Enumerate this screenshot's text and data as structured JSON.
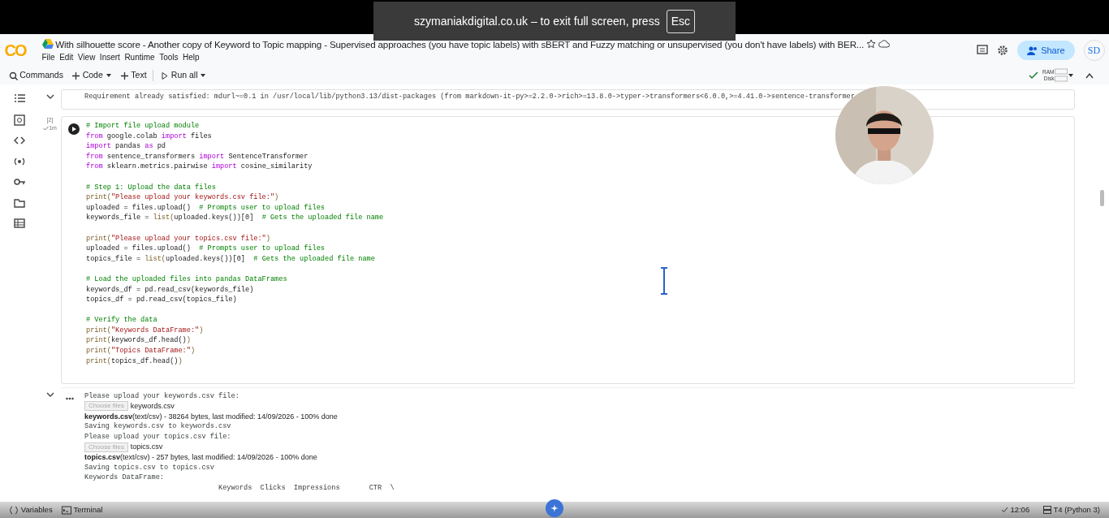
{
  "fullscreen_notice": {
    "text": "szymaniakdigital.co.uk – to exit full screen, press",
    "key": "Esc"
  },
  "header": {
    "logo": "CO",
    "title": "With silhouette score - Another copy of Keyword to Topic mapping - Supervised approaches (you have topic labels) with sBERT and Fuzzy matching or unsupervised (you don't have labels) with BER...",
    "menu": [
      "File",
      "Edit",
      "View",
      "Insert",
      "Runtime",
      "Tools",
      "Help"
    ],
    "share": "Share",
    "avatar": "SD"
  },
  "toolbar": {
    "items": [
      {
        "kind": "search",
        "label": "Commands",
        "caret": false
      },
      {
        "kind": "add",
        "label": "Code",
        "caret": true
      },
      {
        "kind": "add",
        "label": "Text",
        "caret": false
      },
      {
        "kind": "run",
        "label": "Run all",
        "caret": true
      }
    ],
    "ram": "RAM",
    "disk": "Disk"
  },
  "cells": [
    {
      "kind": "output_collapsed",
      "text": "Requirement already satisfied: mdurl~=0.1 in /usr/local/lib/python3.13/dist-packages (from markdown-it-py>=2.2.0->rich>=13.8.0->typer->transformers<6.0.0,>=4.41.0->sentence-transformer"
    },
    {
      "kind": "code",
      "exec_count": "[2]",
      "duration": "1m",
      "blocks": [
        [
          [
            {
              "kind": "comment",
              "text": "# Import file upload module"
            }
          ],
          [
            {
              "kind": "kw",
              "text": "from"
            },
            {
              "kind": "plain",
              "text": " google.colab "
            },
            {
              "kind": "kw",
              "text": "import"
            },
            {
              "kind": "plain",
              "text": " files"
            }
          ],
          [
            {
              "kind": "kw",
              "text": "import"
            },
            {
              "kind": "plain",
              "text": " pandas "
            },
            {
              "kind": "kw",
              "text": "as"
            },
            {
              "kind": "plain",
              "text": " pd"
            }
          ],
          [
            {
              "kind": "kw",
              "text": "from"
            },
            {
              "kind": "plain",
              "text": " sentence_transformers "
            },
            {
              "kind": "kw",
              "text": "import"
            },
            {
              "kind": "plain",
              "text": " SentenceTransformer"
            }
          ],
          [
            {
              "kind": "kw",
              "text": "from"
            },
            {
              "kind": "plain",
              "text": " sklearn.metrics.pairwise "
            },
            {
              "kind": "kw",
              "text": "import"
            },
            {
              "kind": "plain",
              "text": " cosine_similarity"
            }
          ]
        ],
        [
          [
            {
              "kind": "comment",
              "text": "# Step 1: Upload the data files"
            }
          ],
          [
            {
              "kind": "builtin",
              "text": "print("
            },
            {
              "kind": "string",
              "text": "\"Please upload your keywords.csv file:\""
            },
            {
              "kind": "builtin",
              "text": ")"
            }
          ],
          [
            {
              "kind": "plain",
              "text": "uploaded = files.upload()  "
            },
            {
              "kind": "comment",
              "text": "# Prompts user to upload files"
            }
          ],
          [
            {
              "kind": "plain",
              "text": "keywords_file = "
            },
            {
              "kind": "builtin",
              "text": "list("
            },
            {
              "kind": "plain",
              "text": "uploaded.keys())[0]  "
            },
            {
              "kind": "comment",
              "text": "# Gets the uploaded file name"
            }
          ]
        ],
        [
          [
            {
              "kind": "builtin",
              "text": "print("
            },
            {
              "kind": "string",
              "text": "\"Please upload your topics.csv file:\""
            },
            {
              "kind": "builtin",
              "text": ")"
            }
          ],
          [
            {
              "kind": "plain",
              "text": "uploaded = files.upload()  "
            },
            {
              "kind": "comment",
              "text": "# Prompts user to upload files"
            }
          ],
          [
            {
              "kind": "plain",
              "text": "topics_file = "
            },
            {
              "kind": "builtin",
              "text": "list("
            },
            {
              "kind": "plain",
              "text": "uploaded.keys())[0]  "
            },
            {
              "kind": "comment",
              "text": "# Gets the uploaded file name"
            }
          ]
        ],
        [
          [
            {
              "kind": "comment",
              "text": "# Load the uploaded files into pandas DataFrames"
            }
          ],
          [
            {
              "kind": "plain",
              "text": "keywords_df = pd.read_csv(keywords_file)"
            }
          ],
          [
            {
              "kind": "plain",
              "text": "topics_df = pd.read_csv(topics_file)"
            }
          ]
        ],
        [
          [
            {
              "kind": "comment",
              "text": "# Verify the data"
            }
          ],
          [
            {
              "kind": "builtin",
              "text": "print("
            },
            {
              "kind": "string",
              "text": "\"Keywords DataFrame:\""
            },
            {
              "kind": "builtin",
              "text": ")"
            }
          ],
          [
            {
              "kind": "builtin",
              "text": "print("
            },
            {
              "kind": "plain",
              "text": "keywords_df.head()"
            },
            {
              "kind": "builtin",
              "text": ")"
            }
          ],
          [
            {
              "kind": "builtin",
              "text": "print("
            },
            {
              "kind": "string",
              "text": "\"Topics DataFrame:\""
            },
            {
              "kind": "builtin",
              "text": ")"
            }
          ],
          [
            {
              "kind": "builtin",
              "text": "print("
            },
            {
              "kind": "plain",
              "text": "topics_df.head()"
            },
            {
              "kind": "builtin",
              "text": ")"
            }
          ]
        ]
      ]
    },
    {
      "kind": "output",
      "lines": [
        {
          "kind": "text",
          "text": "Please upload your keywords.csv file:"
        },
        {
          "kind": "upload",
          "button": "Choose files",
          "file": "keywords.csv"
        },
        {
          "kind": "info",
          "name": "keywords.csv",
          "rest": "(text/csv) - 38264 bytes, last modified: 14/09/2026 - 100% done"
        },
        {
          "kind": "text",
          "text": "Saving keywords.csv to keywords.csv"
        },
        {
          "kind": "text",
          "text": "Please upload your topics.csv file:"
        },
        {
          "kind": "upload",
          "button": "Choose files",
          "file": "topics.csv"
        },
        {
          "kind": "info",
          "name": "topics.csv",
          "rest": "(text/csv) - 257 bytes, last modified: 14/09/2026 - 100% done"
        },
        {
          "kind": "text",
          "text": "Saving topics.csv to topics.csv"
        },
        {
          "kind": "text",
          "text": "Keywords DataFrame:"
        },
        {
          "kind": "text",
          "text": "                                Keywords  Clicks  Impressions       CTR  \\"
        }
      ]
    }
  ],
  "status_bar": {
    "left": [
      "Variables",
      "Terminal"
    ],
    "time": "12:06",
    "runtime": "T4 (Python 3)"
  }
}
